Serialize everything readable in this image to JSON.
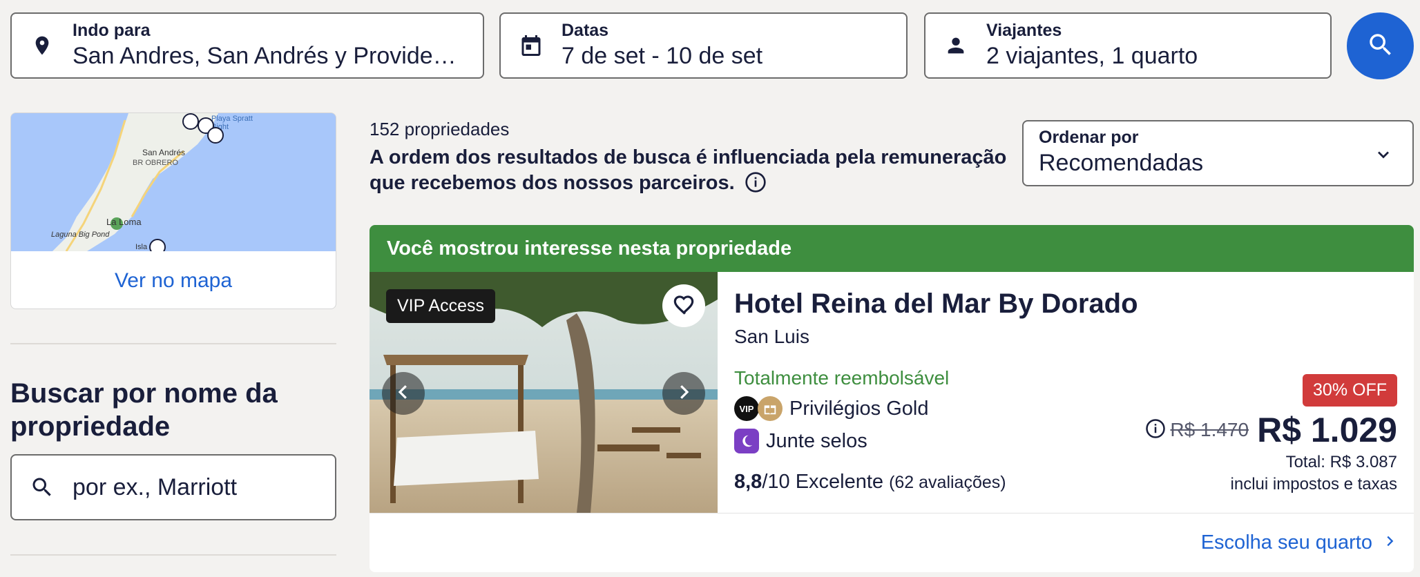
{
  "search": {
    "destination": {
      "label": "Indo para",
      "value": "San Andres, San Andrés y Providencia, Colômbia",
      "icon": "location-pin-icon"
    },
    "dates": {
      "label": "Datas",
      "value": "7 de set - 10 de set",
      "icon": "calendar-icon"
    },
    "travelers": {
      "label": "Viajantes",
      "value": "2 viajantes, 1 quarto",
      "icon": "person-icon"
    },
    "button_icon": "search-icon"
  },
  "map": {
    "link": "Ver no mapa",
    "labels": [
      "Playa Spratt Bight",
      "San Andrés",
      "BR OBRERO",
      "La Loma",
      "Laguna Big Pond",
      "Isla"
    ]
  },
  "property_search": {
    "title": "Buscar por nome da propriedade",
    "placeholder": "por ex., Marriott"
  },
  "results": {
    "count": "152 propriedades",
    "disclaimer": "A ordem dos resultados de busca é influenciada pela remuneração que recebemos dos nossos parceiros."
  },
  "sort": {
    "label": "Ordenar por",
    "value": "Recomendadas"
  },
  "property": {
    "banner": "Você mostrou interesse nesta propriedade",
    "vip_badge": "VIP Access",
    "name": "Hotel Reina del Mar By Dorado",
    "location": "San Luis",
    "refundable": "Totalmente reembolsável",
    "perk_gold": "Privilégios Gold",
    "vip_mark": "VIP",
    "perk_stamps": "Junte selos",
    "rating_score": "8,8",
    "rating_scale": "/10 Excelente",
    "rating_reviews": "(62 avaliações)",
    "discount": "30% OFF",
    "old_price": "R$ 1.470",
    "price": "R$ 1.029",
    "total": "Total: R$ 3.087",
    "taxes": "inclui impostos e taxas",
    "cta": "Escolha seu quarto"
  },
  "colors": {
    "accent": "#1e63d3",
    "banner": "#3e8e3f",
    "discount": "#d13b3b",
    "background": "#f3f2f0"
  }
}
